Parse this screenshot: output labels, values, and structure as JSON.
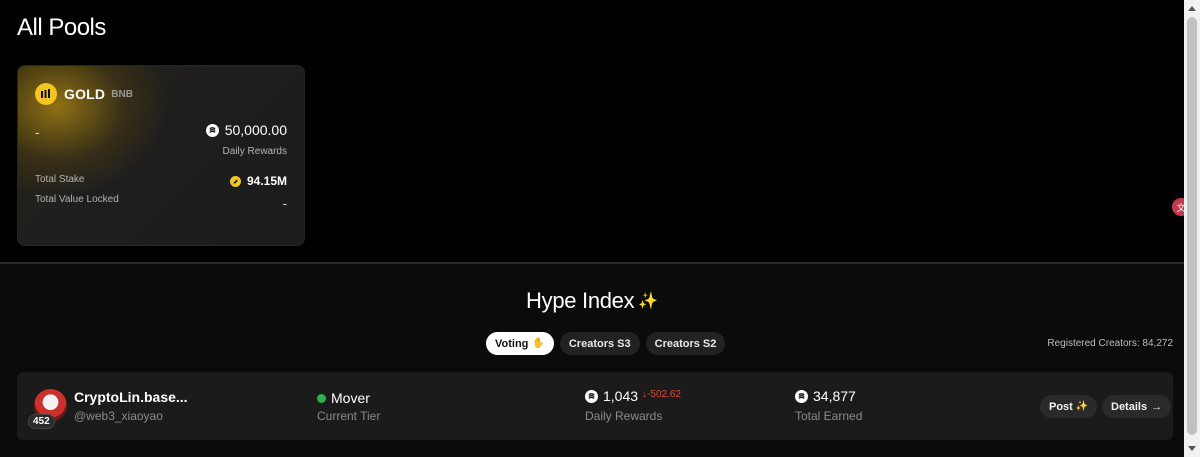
{
  "page": {
    "title": "All Pools"
  },
  "pool": {
    "name": "GOLD",
    "chain": "BNB",
    "left_value": "-",
    "daily_rewards": "50,000.00",
    "daily_rewards_label": "Daily Rewards",
    "total_stake_label": "Total Stake",
    "total_stake_value": "94.15M",
    "tvl_label": "Total Value Locked",
    "tvl_value": "-"
  },
  "hype": {
    "title": "Hype Index",
    "tabs": [
      {
        "label": "Voting",
        "active": true
      },
      {
        "label": "Creators S3",
        "active": false
      },
      {
        "label": "Creators S2",
        "active": false
      }
    ],
    "registered_creators": "Registered Creators: 84,272"
  },
  "creator": {
    "rank": "452",
    "name": "CryptoLin.base...",
    "handle": "@web3_xiaoyao",
    "tier": "Mover",
    "tier_label": "Current Tier",
    "daily_rewards": "1,043",
    "daily_change": "↓-502.62",
    "daily_rewards_label": "Daily Rewards",
    "total_earned": "34,877",
    "total_earned_label": "Total Earned",
    "post_label": "Post",
    "details_label": "Details"
  },
  "colors": {
    "gold": "#f3c623",
    "negative": "#e04a3c",
    "tier_green": "#2bb24c",
    "sparkle": "#c58cff"
  }
}
